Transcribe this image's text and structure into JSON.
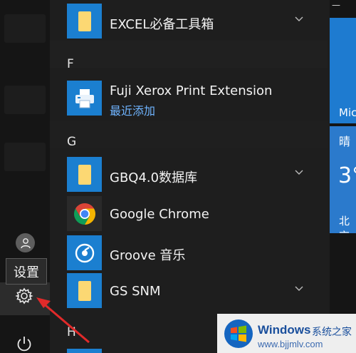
{
  "rail": {
    "tooltip": "设置"
  },
  "apps": [
    {
      "name": "EXCEL必备工具箱",
      "icon": "folder-icon",
      "expandable": true
    },
    {
      "name": "Fuji Xerox Print Extension",
      "sub": "最近添加",
      "icon": "printer-icon"
    },
    {
      "name": "GBQ4.0数据库",
      "icon": "folder-icon",
      "expandable": true
    },
    {
      "name": "Google Chrome",
      "icon": "chrome-icon"
    },
    {
      "name": "Groove 音乐",
      "icon": "groove-music-icon"
    },
    {
      "name": "GS SNM",
      "icon": "folder-icon",
      "expandable": true
    }
  ],
  "letters": [
    "F",
    "G",
    "H"
  ],
  "tiles": {
    "top_caption": "Mic",
    "weather_cond": "晴",
    "weather_temp": "3°",
    "weather_city": "北京"
  },
  "watermark": {
    "brand": "Windows",
    "cn": "系统之家",
    "url": "www.bjjmlv.com"
  },
  "colors": {
    "accent": "#1b7fd0",
    "folder": "#fcd873",
    "link": "#6fb4ff",
    "arrow": "#e12a2a"
  }
}
